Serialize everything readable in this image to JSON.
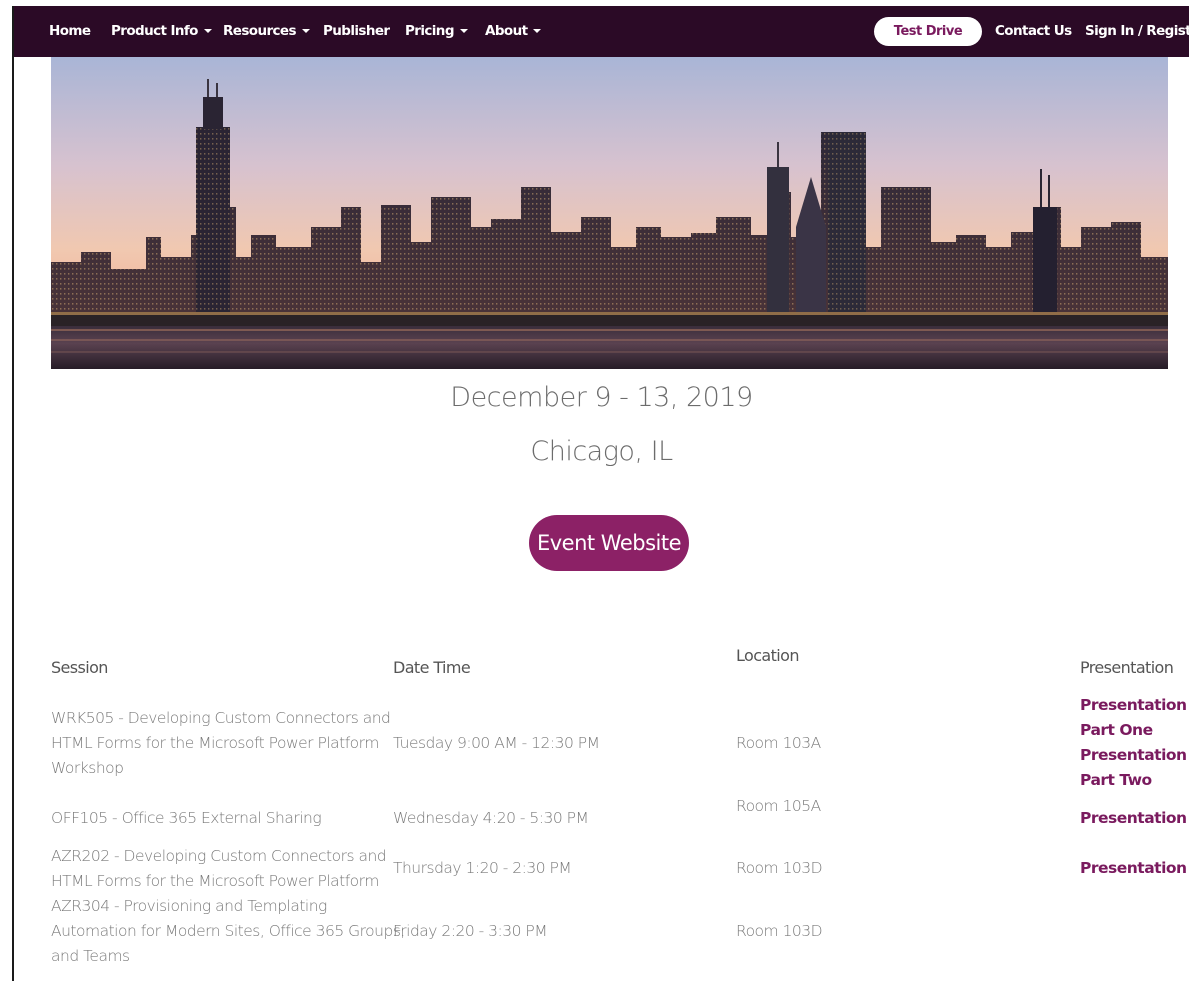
{
  "nav": {
    "home": "Home",
    "product_info": "Product Info",
    "resources": "Resources",
    "publisher": "Publisher",
    "pricing": "Pricing",
    "about": "About",
    "test_drive": "Test Drive",
    "contact_us": "Contact Us",
    "sign_in": "Sign In / Register"
  },
  "event": {
    "date": "December 9 - 13, 2019",
    "location": "Chicago, IL",
    "website_button": "Event Website"
  },
  "table": {
    "headers": {
      "session": "Session",
      "datetime": "Date Time",
      "location": "Location",
      "presentation": "Presentation"
    },
    "rows": [
      {
        "session_lines": [
          "WRK505 - Developing Custom Connectors and",
          "HTML Forms for the Microsoft Power Platform",
          "Workshop"
        ],
        "datetime": "Tuesday 9:00 AM - 12:30 PM",
        "location": "Room 103A",
        "links": [
          "Presentation",
          "Part One",
          "Presentation",
          "Part Two"
        ]
      },
      {
        "session_lines": [
          "OFF105 - Office 365 External Sharing"
        ],
        "datetime": "Wednesday 4:20 - 5:30 PM",
        "location": "Room 105A",
        "links": [
          "Presentation"
        ]
      },
      {
        "session_lines": [
          "AZR202 - Developing Custom Connectors and",
          "HTML Forms for the Microsoft Power Platform"
        ],
        "datetime": "Thursday 1:20 - 2:30 PM",
        "location": "Room 103D",
        "links": [
          "Presentation"
        ]
      },
      {
        "session_lines": [
          "AZR304 - Provisioning and Templating",
          "Automation for Modern Sites, Office 365 Groups,",
          "and Teams"
        ],
        "datetime": "Friday 2:20 - 3:30 PM",
        "location": "Room 103D",
        "links": []
      }
    ]
  },
  "colors": {
    "nav_bg": "#2b0a26",
    "accent": "#8c2166",
    "link": "#7a1a5e"
  }
}
